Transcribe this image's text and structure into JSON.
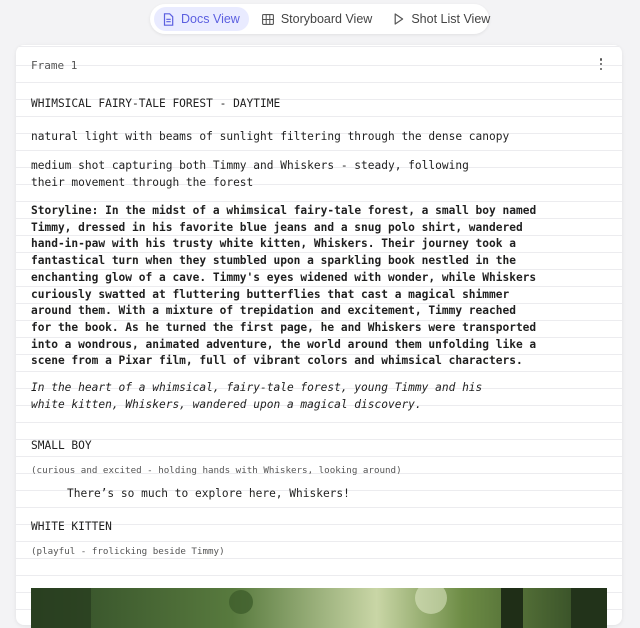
{
  "tabs": [
    {
      "label": "Docs View",
      "active": true,
      "icon": "document-icon"
    },
    {
      "label": "Storyboard View",
      "active": false,
      "icon": "grid-icon"
    },
    {
      "label": "Shot List View",
      "active": false,
      "icon": "play-icon"
    }
  ],
  "frame": {
    "label": "Frame 1",
    "scene_heading": "WHIMSICAL FAIRY-TALE FOREST - DAYTIME",
    "lighting": "natural light with beams of sunlight filtering through the dense canopy",
    "camera": "medium shot capturing both Timmy and Whiskers - steady, following their movement through the forest",
    "storyline_label": "Storyline:",
    "storyline": "In the midst of a whimsical fairy-tale forest, a small boy named Timmy, dressed in his favorite blue jeans and a snug polo shirt, wandered hand-in-paw with his trusty white kitten, Whiskers. Their journey took a fantastical turn when they stumbled upon a sparkling book nestled in the enchanting glow of a cave. Timmy's eyes widened with wonder, while Whiskers curiously swatted at fluttering butterflies that cast a magical shimmer around them. With a mixture of trepidation and excitement, Timmy reached for the book. As he turned the first page, he and Whiskers were transported into a wondrous, animated adventure, the world around them unfolding like a scene from a Pixar film, full of vibrant colors and whimsical characters.",
    "summary": "In the heart of a whimsical, fairy-tale forest, young Timmy and his white kitten, Whiskers, wandered upon a magical discovery.",
    "character_1": "SMALL BOY",
    "parenthetical_1": "(curious and excited - holding hands with Whiskers, looking around)",
    "dialogue_1": "There’s so much to explore here, Whiskers!",
    "character_2": "WHITE KITTEN",
    "parenthetical_2": "(playful - frolicking beside Timmy)"
  },
  "colors": {
    "page_bg": "#f3f3f5",
    "accent": "#5b5fe0",
    "active_tab_bg": "#e9ebff"
  }
}
